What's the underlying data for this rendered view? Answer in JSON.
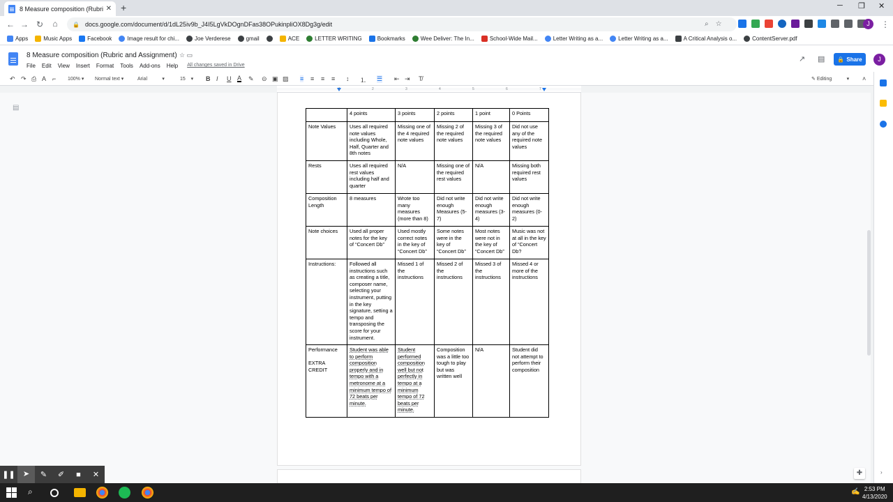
{
  "browser": {
    "tab_title": "8 Measure composition (Rubric a",
    "url": "docs.google.com/document/d/1dL25iv9b_J4I5LgVkDOgnDFas38OPukinpliOX8Dg3g/edit",
    "bookmarks": [
      {
        "label": "Apps",
        "color": "#4285f4"
      },
      {
        "label": "Music Apps",
        "color": "#f4b400"
      },
      {
        "label": "Facebook",
        "color": "#1877f2"
      },
      {
        "label": "Image result for chi...",
        "color": "#4285f4"
      },
      {
        "label": "Joe Verderese",
        "color": "#3c4043"
      },
      {
        "label": "gmail",
        "color": "#3c4043"
      },
      {
        "label": "",
        "color": "#3c4043"
      },
      {
        "label": "ACE",
        "color": "#f4b400"
      },
      {
        "label": "LETTER WRITING",
        "color": "#2e7d32"
      },
      {
        "label": "Bookmarks",
        "color": "#1a73e8"
      },
      {
        "label": "Wee Deliver: The In...",
        "color": "#2e7d32"
      },
      {
        "label": "School-Wide Mail...",
        "color": "#d93025"
      },
      {
        "label": "Letter Writing as a...",
        "color": "#4285f4"
      },
      {
        "label": "Letter Writing as a...",
        "color": "#4285f4"
      },
      {
        "label": "A Critical Analysis o...",
        "color": "#3c4043"
      },
      {
        "label": "ContentServer.pdf",
        "color": "#3c4043"
      }
    ],
    "profile_initial": "J"
  },
  "docs": {
    "title": "8 Measure composition (Rubric and Assignment)",
    "menu": [
      "File",
      "Edit",
      "View",
      "Insert",
      "Format",
      "Tools",
      "Add-ons",
      "Help"
    ],
    "saved_status": "All changes saved in Drive",
    "share_label": "Share",
    "avatar_initial": "J",
    "toolbar": {
      "zoom": "100%",
      "style": "Normal text",
      "font": "Arial",
      "size": "15",
      "mode": "Editing"
    },
    "ruler_marks": [
      "1",
      "2",
      "3",
      "4",
      "5",
      "6",
      "7"
    ]
  },
  "rubric": {
    "header": [
      "",
      "4 points",
      "3 points",
      "2 points",
      "1 point",
      "0 Points"
    ],
    "rows": [
      {
        "category": "Note Values",
        "cells": [
          "Uses all required note values including Whole, Half, Quarter and 8th notes",
          "Missing one of the 4 required note values",
          "Missing 2 of the required note values",
          "Missing 3 of the required note values",
          "Did not use any of the required note values"
        ]
      },
      {
        "category": "Rests",
        "cells": [
          "Uses all required rest values including half and quarter",
          "N/A",
          "Missing one of the required rest values",
          "N/A",
          "Missing both required rest values"
        ]
      },
      {
        "category": "Composition Length",
        "cells": [
          "8 measures",
          "Wrote too many measures (more than 8)",
          "Did not write enough Measures (5-7)",
          "Did not write enough measures (3-4)",
          "Did not write enough measures (0-2)"
        ]
      },
      {
        "category": "Note choices",
        "cells": [
          "Used all proper notes for the key of “Concert Db”",
          "Used mostly correct notes in the key of “Concert Db”",
          "Some notes were in the key of “Concert Db”",
          "Most notes were not in the key of “Concert Db”",
          "Music was not at all in the key of “Concert Db?"
        ]
      },
      {
        "category": "Instructions:",
        "cells": [
          "Followed all instructions such as creating a title, composer name, selecting your instrument, putting in the key signature, setting a tempo and transposing the score for your instrument.",
          "Missed 1 of the instructions",
          "Missed 2 of the instructions",
          "Missed 3 of the instructions",
          "Missed 4 or more of the instructions"
        ]
      },
      {
        "category": "Performance",
        "category_note": "EXTRA CREDIT",
        "cells": [
          "Student was able to perform composition properly and in tempo with a metronome at a minimum tempo of 72 beats per minute.",
          "Student performed composition well but not perfectly in tempo at a minimum tempo of 72 beats per minute.",
          "Composition was a little too tough to play but was written well",
          "N/A",
          "Student did not attempt to perform their composition"
        ]
      }
    ]
  },
  "taskbar": {
    "time": "2:53 PM",
    "date": "4/13/2020"
  }
}
